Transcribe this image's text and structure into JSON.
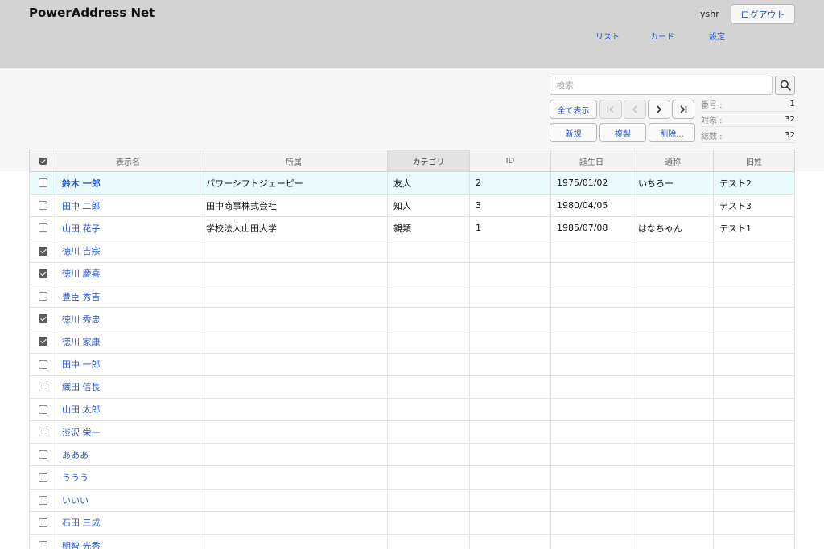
{
  "header": {
    "title": "PowerAddress Net",
    "user": "yshr",
    "logout_label": "ログアウト",
    "nav": [
      "リスト",
      "カード",
      "設定"
    ]
  },
  "toolbar": {
    "search_placeholder": "検索",
    "show_all_label": "全て表示",
    "new_label": "新規",
    "copy_label": "複製",
    "delete_label": "削除...",
    "pager": {
      "first": "|<",
      "prev": "<",
      "next": ">",
      "last": ">|"
    }
  },
  "stats": {
    "number_label": "番号 :",
    "number": "1",
    "target_label": "対象 :",
    "target": "32",
    "total_label": "総数 :",
    "total": "32"
  },
  "table": {
    "columns": [
      "表示名",
      "所属",
      "カテゴリ",
      "ID",
      "誕生日",
      "通称",
      "旧姓"
    ],
    "rows": [
      {
        "checked": false,
        "name": "鈴木 一郎",
        "org": "パワーシフトジェーピー",
        "category": "友人",
        "id": "2",
        "birthday": "1975/01/02",
        "alias": "いちろー",
        "maiden": "テスト2"
      },
      {
        "checked": false,
        "name": "田中 二郎",
        "org": "田中商事株式会社",
        "category": "知人",
        "id": "3",
        "birthday": "1980/04/05",
        "alias": "",
        "maiden": "テスト3"
      },
      {
        "checked": false,
        "name": "山田 花子",
        "org": "学校法人山田大学",
        "category": "親類",
        "id": "1",
        "birthday": "1985/07/08",
        "alias": "はなちゃん",
        "maiden": "テスト1"
      },
      {
        "checked": true,
        "name": "徳川 吉宗",
        "org": "",
        "category": "",
        "id": "",
        "birthday": "",
        "alias": "",
        "maiden": ""
      },
      {
        "checked": true,
        "name": "徳川 慶喜",
        "org": "",
        "category": "",
        "id": "",
        "birthday": "",
        "alias": "",
        "maiden": ""
      },
      {
        "checked": false,
        "name": "豊臣 秀吉",
        "org": "",
        "category": "",
        "id": "",
        "birthday": "",
        "alias": "",
        "maiden": ""
      },
      {
        "checked": true,
        "name": "徳川 秀忠",
        "org": "",
        "category": "",
        "id": "",
        "birthday": "",
        "alias": "",
        "maiden": ""
      },
      {
        "checked": true,
        "name": "徳川 家康",
        "org": "",
        "category": "",
        "id": "",
        "birthday": "",
        "alias": "",
        "maiden": ""
      },
      {
        "checked": false,
        "name": "田中 一郎",
        "org": "",
        "category": "",
        "id": "",
        "birthday": "",
        "alias": "",
        "maiden": ""
      },
      {
        "checked": false,
        "name": "織田 信長",
        "org": "",
        "category": "",
        "id": "",
        "birthday": "",
        "alias": "",
        "maiden": ""
      },
      {
        "checked": false,
        "name": "山田 太郎",
        "org": "",
        "category": "",
        "id": "",
        "birthday": "",
        "alias": "",
        "maiden": ""
      },
      {
        "checked": false,
        "name": "渋沢 栄一",
        "org": "",
        "category": "",
        "id": "",
        "birthday": "",
        "alias": "",
        "maiden": ""
      },
      {
        "checked": false,
        "name": "あああ",
        "org": "",
        "category": "",
        "id": "",
        "birthday": "",
        "alias": "",
        "maiden": ""
      },
      {
        "checked": false,
        "name": "ううう",
        "org": "",
        "category": "",
        "id": "",
        "birthday": "",
        "alias": "",
        "maiden": ""
      },
      {
        "checked": false,
        "name": "いいい",
        "org": "",
        "category": "",
        "id": "",
        "birthday": "",
        "alias": "",
        "maiden": ""
      },
      {
        "checked": false,
        "name": "石田 三成",
        "org": "",
        "category": "",
        "id": "",
        "birthday": "",
        "alias": "",
        "maiden": ""
      },
      {
        "checked": false,
        "name": "明智 光秀",
        "org": "",
        "category": "",
        "id": "",
        "birthday": "",
        "alias": "",
        "maiden": ""
      }
    ]
  },
  "colors": {
    "accent": "#2a56c6",
    "header_bg": "#d3d3d3",
    "selected_row": "#eafbfc"
  },
  "icons": {
    "search": "search-icon"
  }
}
